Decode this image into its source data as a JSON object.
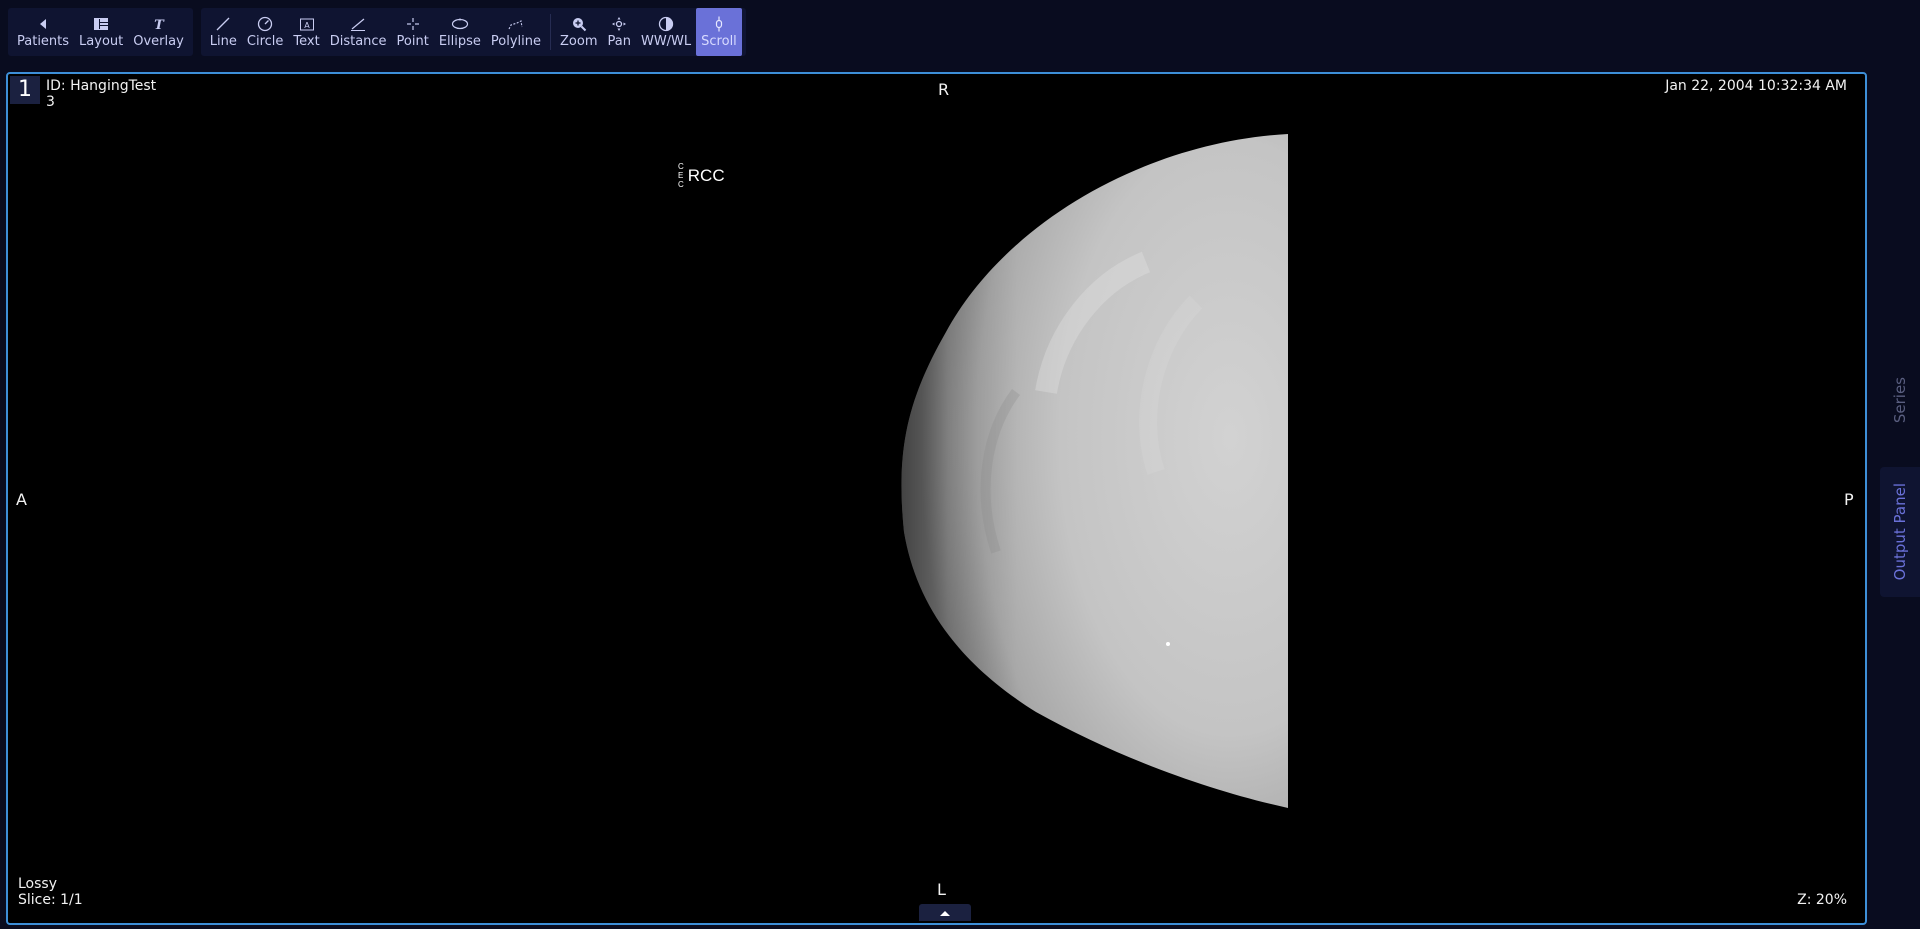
{
  "toolbar": {
    "nav_tools": [
      {
        "label": "Patients",
        "icon": "chevron-left-icon"
      },
      {
        "label": "Layout",
        "icon": "layout-grid-icon"
      },
      {
        "label": "Overlay",
        "icon": "overlay-text-icon"
      }
    ],
    "annotation_tools": [
      {
        "label": "Line",
        "icon": "line-icon"
      },
      {
        "label": "Circle",
        "icon": "circle-icon"
      },
      {
        "label": "Text",
        "icon": "text-box-icon"
      },
      {
        "label": "Distance",
        "icon": "distance-icon"
      },
      {
        "label": "Point",
        "icon": "point-icon"
      },
      {
        "label": "Ellipse",
        "icon": "ellipse-icon"
      },
      {
        "label": "Polyline",
        "icon": "polyline-icon"
      }
    ],
    "view_tools": [
      {
        "label": "Zoom",
        "icon": "zoom-icon"
      },
      {
        "label": "Pan",
        "icon": "pan-icon"
      },
      {
        "label": "WW/WL",
        "icon": "contrast-icon"
      },
      {
        "label": "Scroll",
        "icon": "scroll-icon",
        "active": true
      }
    ]
  },
  "viewport": {
    "index": "1",
    "patient_id": "ID: HangingTest",
    "series_number": "3",
    "datetime": "Jan 22, 2004 10:32:34 AM",
    "compression": "Lossy",
    "slice": "Slice: 1/1",
    "zoom": "Z: 20%",
    "orientation": {
      "top": "R",
      "bottom": "L",
      "left": "A",
      "right": "P"
    },
    "image_marker": {
      "small_letters": [
        "C",
        "E",
        "C"
      ],
      "label": "RCC"
    }
  },
  "side_panel": {
    "series_label": "Series",
    "output_label": "Output Panel"
  },
  "colors": {
    "accent": "#6a71d8",
    "viewport_border": "#3d8fd8",
    "toolbar_bg": "#0f1431",
    "page_bg": "#090c1f"
  }
}
